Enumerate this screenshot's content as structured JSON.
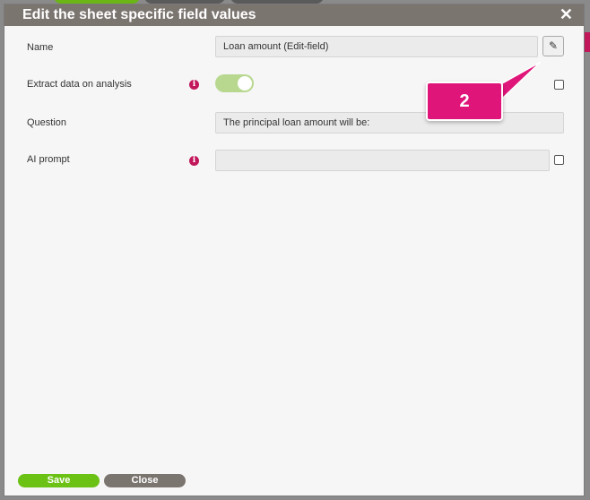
{
  "dialog": {
    "title": "Edit the sheet specific field values",
    "close_icon": "close-icon"
  },
  "fields": {
    "name": {
      "label": "Name",
      "value": "Loan amount (Edit-field)"
    },
    "extract": {
      "label": "Extract data on analysis",
      "toggle_on": true
    },
    "question": {
      "label": "Question",
      "value": "The principal loan amount will be:"
    },
    "ai_prompt": {
      "label": "AI prompt",
      "value": ""
    }
  },
  "info_icon_glyph": "i",
  "callout": {
    "text": "2",
    "color": "#e0157a"
  },
  "buttons": {
    "save": "Save",
    "close": "Close"
  },
  "colors": {
    "accent_green": "#6bc114",
    "header": "#7b7570",
    "info": "#c2185b"
  }
}
